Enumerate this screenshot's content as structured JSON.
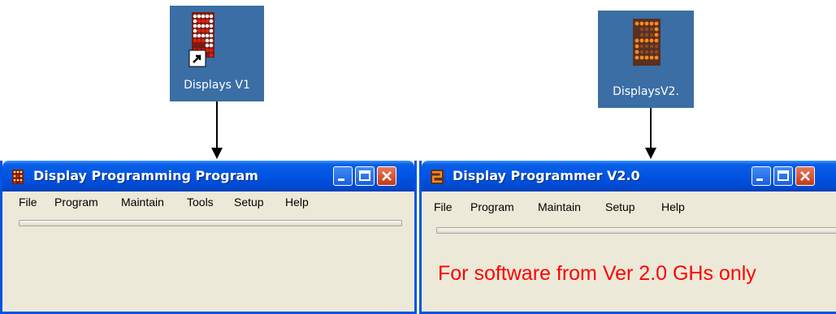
{
  "desktop": {
    "icon_v1": {
      "label": "Displays V1"
    },
    "icon_v2": {
      "label": "DisplaysV2."
    }
  },
  "window_v1": {
    "title": "Display Programming Program",
    "menu": [
      "File",
      "Program",
      "Maintain",
      "Tools",
      "Setup",
      "Help"
    ]
  },
  "window_v2": {
    "title": "Display Programmer V2.0",
    "menu": [
      "File",
      "Program",
      "Maintain",
      "Setup",
      "Help"
    ],
    "notice": "For software from Ver 2.0 GHs only"
  },
  "colors": {
    "titlebar": "#0054e3",
    "window_face": "#ece9d8",
    "notice_text": "#ff0000",
    "desktop_tile": "#3a6ea5"
  },
  "icons": [
    "led-matrix-icon",
    "shortcut-arrow-icon",
    "minimize-icon",
    "maximize-icon",
    "close-icon"
  ]
}
